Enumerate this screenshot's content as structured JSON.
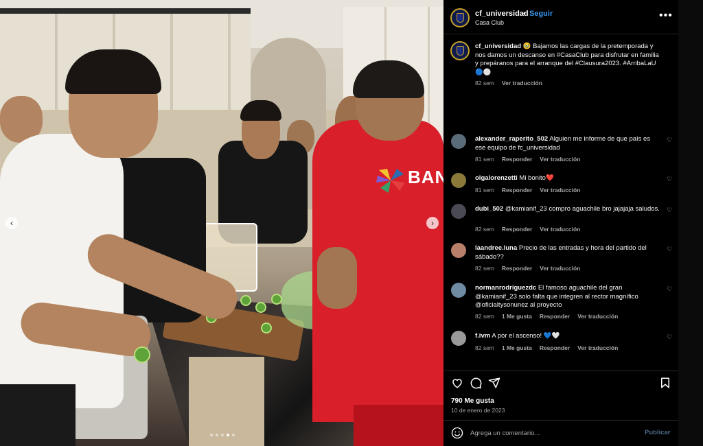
{
  "post_header": {
    "username": "cf_universidad",
    "separator": "•",
    "follow_label": "Seguir",
    "location": "Casa Club",
    "more_glyph": "•••"
  },
  "photo": {
    "sponsor_text": "BAN",
    "prev_glyph": "‹",
    "next_glyph": "›",
    "carousel_count": 5,
    "carousel_active_index": 3
  },
  "caption": {
    "username": "cf_universidad",
    "text": "🥹 Bajamos las cargas de la pretemporada y nos damos un descanso en #CasaClub para disfrutar en familia y prepáranos para el arranque del #Clausura2023. #ArribaLaU 🔵⚪",
    "time": "82 sem",
    "translate": "Ver traducción"
  },
  "comments": [
    {
      "username": "alexander_raperito_502",
      "text": "Alguien me informe de que país es ese equipo de fc_universidad",
      "time": "81 sem",
      "likes": "",
      "reply": "Responder",
      "translate": "Ver traducción",
      "avatar_color": "#5a6b7a"
    },
    {
      "username": "olgalorenzetti",
      "text": "Mi bonito❤️",
      "time": "81 sem",
      "likes": "",
      "reply": "Responder",
      "translate": "Ver traducción",
      "avatar_color": "#8a7a3a"
    },
    {
      "username": "dubi_502",
      "text": "@kamianif_23 compro aguachile bro jajajaja saludos.",
      "time": "82 sem",
      "likes": "",
      "reply": "Responder",
      "translate": "Ver traducción",
      "avatar_color": "#4a4a55"
    },
    {
      "username": "laandree.luna",
      "text": "Precio de las entradas y hora del partido del sábado??",
      "time": "82 sem",
      "likes": "",
      "reply": "Responder",
      "translate": "Ver traducción",
      "avatar_color": "#b87f6a"
    },
    {
      "username": "normanrodriguezdc",
      "text": "El famoso aguachile del gran @kamianif_23 solo falta que integren al rector magnífico @oficialtysonunez al proyecto",
      "time": "82 sem",
      "likes": "1 Me gusta",
      "reply": "Responder",
      "translate": "Ver traducción",
      "avatar_color": "#6f8aa3"
    },
    {
      "username": "f.ivm",
      "text": "A por el ascenso! 💙🤍",
      "time": "82 sem",
      "likes": "1 Me gusta",
      "reply": "Responder",
      "translate": "Ver traducción",
      "avatar_color": "#9a9a9a"
    }
  ],
  "actions": {
    "likes": "790 Me gusta",
    "date": "10 de enero de 2023"
  },
  "add_comment": {
    "placeholder": "Agrega un comentario...",
    "publish_label": "Publicar"
  },
  "colors": {
    "accent_link": "#3897f0",
    "publish_disabled": "#4d6a8a",
    "jersey_red": "#d81f2a"
  }
}
